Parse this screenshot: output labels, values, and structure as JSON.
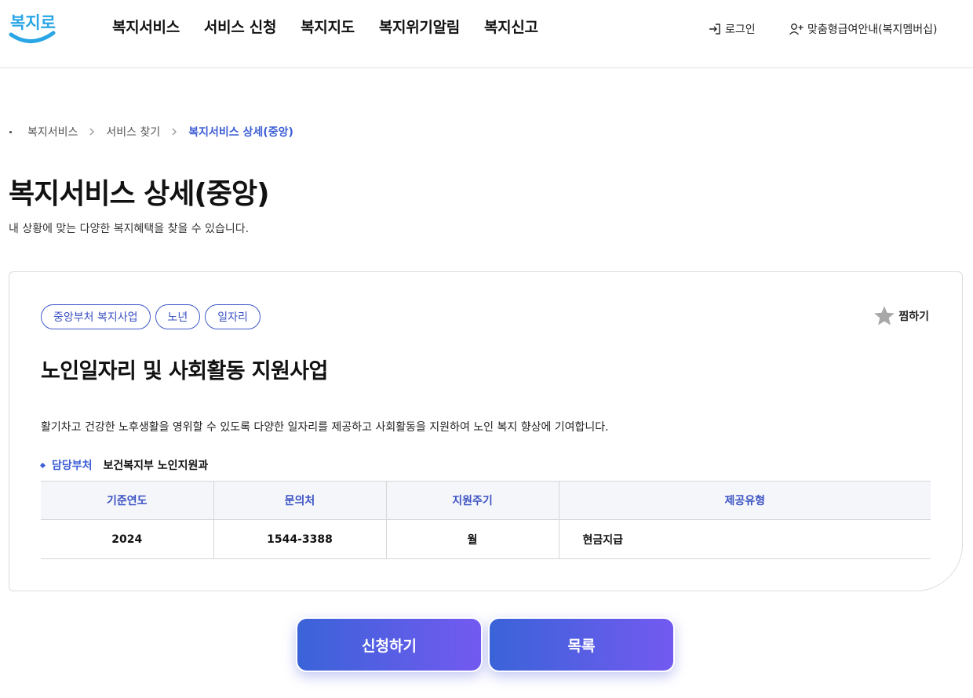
{
  "header": {
    "logo_text": "복지로",
    "nav": [
      "복지서비스",
      "서비스 신청",
      "복지지도",
      "복지위기알림",
      "복지신고"
    ],
    "login_label": "로그인",
    "member_label": "맞춤형급여안내(복지멤버십)"
  },
  "breadcrumb": {
    "items": [
      "복지서비스",
      "서비스 찾기"
    ],
    "current": "복지서비스 상세(중앙)"
  },
  "page": {
    "title": "복지서비스 상세(중앙)",
    "description": "내 상황에 맞는 다양한 복지혜택을 찾을 수 있습니다."
  },
  "service": {
    "tags": [
      "중앙부처 복지사업",
      "노년",
      "일자리"
    ],
    "favorite_label": "찜하기",
    "title": "노인일자리 및 사회활동 지원사업",
    "description": "활기차고 건강한 노후생활을 영위할 수 있도록 다양한 일자리를 제공하고 사회활동을 지원하여 노인 복지 향상에 기여합니다.",
    "dept_label": "담당부처",
    "dept_value": "보건복지부 노인지원과",
    "table": {
      "headers": [
        "기준연도",
        "문의처",
        "지원주기",
        "제공유형"
      ],
      "row": [
        "2024",
        "1544-3388",
        "월",
        "현금지급"
      ]
    }
  },
  "actions": {
    "apply_label": "신청하기",
    "list_label": "목록"
  },
  "colors": {
    "accent": "#3d5ed6",
    "logo_blue": "#2aa6e6",
    "button_gradient_start": "#3a63d8",
    "button_gradient_end": "#735af0"
  }
}
